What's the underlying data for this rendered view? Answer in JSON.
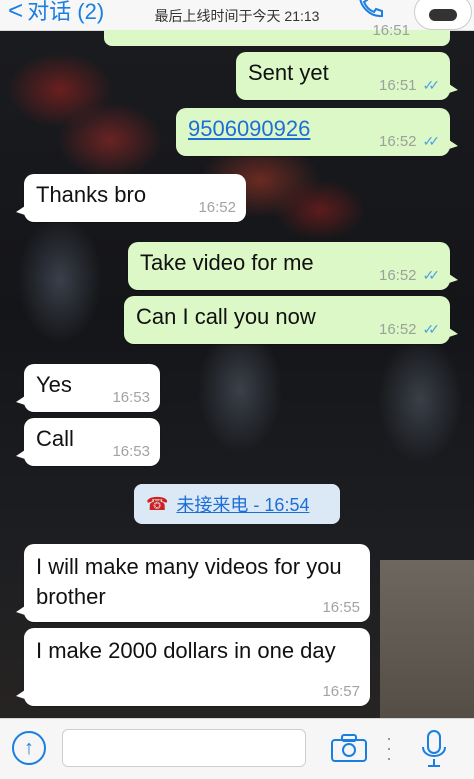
{
  "header": {
    "back_chevron": "<",
    "back_label": "对话 (2)",
    "status_text": "最后上线时间于今天 21:13",
    "icons": {
      "back": "chevron-left-icon",
      "call": "phone-icon",
      "avatar": "contact-avatar"
    }
  },
  "previous_message_time": "16:51",
  "messages": [
    {
      "direction": "out",
      "text": "Sent yet",
      "time": "16:51",
      "status": "read"
    },
    {
      "direction": "out",
      "text": "9506090926",
      "time": "16:52",
      "status": "read",
      "is_link": true
    },
    {
      "direction": "in",
      "text": "Thanks bro",
      "time": "16:52"
    },
    {
      "direction": "out",
      "text": "Take video for me",
      "time": "16:52",
      "status": "read"
    },
    {
      "direction": "out",
      "text": "Can I call you now",
      "time": "16:52",
      "status": "read"
    },
    {
      "direction": "in",
      "text": "Yes",
      "time": "16:53"
    },
    {
      "direction": "in",
      "text": "Call",
      "time": "16:53"
    },
    {
      "direction": "in",
      "text": "I will make many videos for you brother",
      "time": "16:55"
    },
    {
      "direction": "in",
      "text": "I make 2000 dollars in one day",
      "time": "16:57"
    }
  ],
  "missed_call": {
    "label": "未接来电 - 16:54",
    "icon": "missed-call-icon"
  },
  "input_bar": {
    "placeholder": "",
    "icons": {
      "attach": "arrow-up-icon",
      "camera": "camera-icon",
      "more": "more-dots-icon",
      "mic": "microphone-icon"
    }
  },
  "colors": {
    "outgoing_bubble": "#dcf8c6",
    "incoming_bubble": "#ffffff",
    "accent": "#1a7fe0",
    "read_ticks": "#4fa3e0",
    "missed_call_bg": "#dbe9f6"
  }
}
